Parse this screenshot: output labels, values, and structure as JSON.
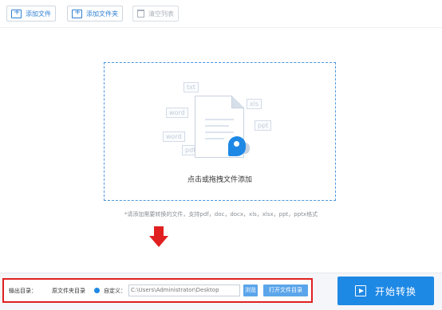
{
  "toolbar": {
    "add_file": "添加文件",
    "add_folder": "添加文件夹",
    "clear_list": "清空列表"
  },
  "dropzone": {
    "text": "点击或拖拽文件添加",
    "tags": [
      "txt",
      "word",
      "xls",
      "ppt",
      "word",
      "pdf"
    ]
  },
  "hint": "*请添加需要转换的文件，支持pdf，doc，docx，xls，xlsx，ppt，pptx格式",
  "output": {
    "label": "输出目录：",
    "origin_option": "原文件夹目录",
    "custom_option": "自定义：",
    "path_value": "C:\\Users\\Administrator\\Desktop",
    "browse": "浏览",
    "open_folder": "打开文件目录"
  },
  "start_button": "开始转换",
  "colors": {
    "accent": "#1e88e5",
    "highlight_red": "#e02020"
  }
}
